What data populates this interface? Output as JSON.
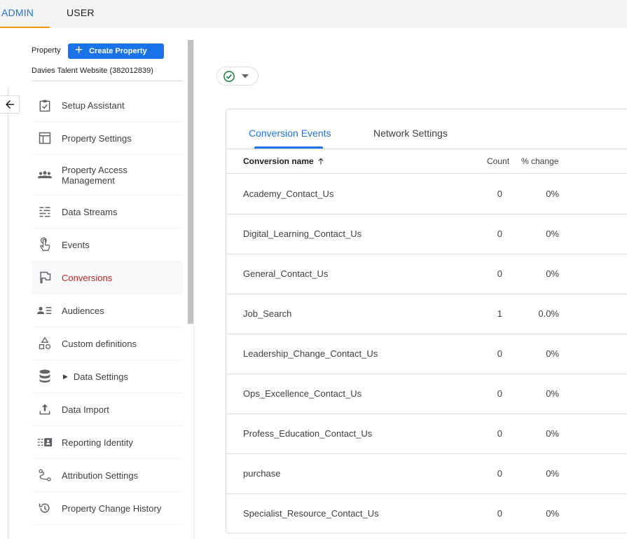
{
  "top_tabs": {
    "admin": "ADMIN",
    "user": "USER"
  },
  "property": {
    "label": "Property",
    "create_button": "Create Property",
    "selected": "Davies Talent Website (382012839)"
  },
  "sidebar": {
    "items": [
      {
        "label": "Setup Assistant",
        "icon": "clipboard-check-icon"
      },
      {
        "label": "Property Settings",
        "icon": "layout-icon"
      },
      {
        "label": "Property Access Management",
        "icon": "people-icon"
      },
      {
        "label": "Data Streams",
        "icon": "data-streams-icon"
      },
      {
        "label": "Events",
        "icon": "touch-icon"
      },
      {
        "label": "Conversions",
        "icon": "flag-icon",
        "active": true
      },
      {
        "label": "Audiences",
        "icon": "audience-list-icon"
      },
      {
        "label": "Custom definitions",
        "icon": "shapes-icon"
      },
      {
        "label": "Data Settings",
        "icon": "database-icon"
      },
      {
        "label": "Data Import",
        "icon": "upload-icon"
      },
      {
        "label": "Reporting Identity",
        "icon": "reporting-identity-icon"
      },
      {
        "label": "Attribution Settings",
        "icon": "attribution-icon"
      },
      {
        "label": "Property Change History",
        "icon": "history-icon"
      }
    ]
  },
  "status_chip": {
    "icon": "check-circle-icon",
    "color": "#188038"
  },
  "tabs": [
    "Conversion Events",
    "Network Settings"
  ],
  "table": {
    "headers": {
      "name": "Conversion name",
      "count": "Count",
      "change": "% change"
    },
    "rows": [
      {
        "name": "Academy_Contact_Us",
        "count": "0",
        "change": "0%"
      },
      {
        "name": "Digital_Learning_Contact_Us",
        "count": "0",
        "change": "0%"
      },
      {
        "name": "General_Contact_Us",
        "count": "0",
        "change": "0%"
      },
      {
        "name": "Job_Search",
        "count": "1",
        "change": "0.0%"
      },
      {
        "name": "Leadership_Change_Contact_Us",
        "count": "0",
        "change": "0%"
      },
      {
        "name": "Ops_Excellence_Contact_Us",
        "count": "0",
        "change": "0%"
      },
      {
        "name": "Profess_Education_Contact_Us",
        "count": "0",
        "change": "0%"
      },
      {
        "name": "purchase",
        "count": "0",
        "change": "0%"
      },
      {
        "name": "Specialist_Resource_Contact_Us",
        "count": "0",
        "change": "0%"
      }
    ]
  },
  "colors": {
    "accent": "#1a73e8",
    "active_nav": "#c5221f",
    "admin_underline": "#f29900"
  }
}
